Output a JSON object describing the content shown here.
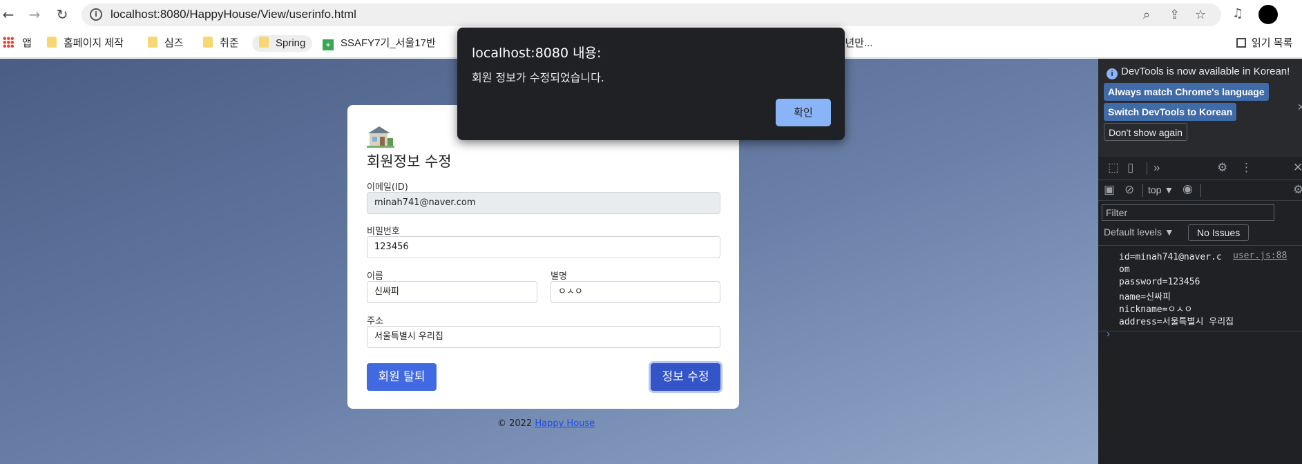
{
  "browser": {
    "url": "localhost:8080/HappyHouse/View/userinfo.html",
    "back_icon": "arrow-left-icon",
    "forward_icon": "arrow-right-icon",
    "reload_icon": "reload-icon"
  },
  "bookmarks": [
    {
      "label": "앱",
      "icon": "apps-grid-icon"
    },
    {
      "label": "홈페이지 제작",
      "icon": "folder-icon"
    },
    {
      "label": "심즈",
      "icon": "folder-icon"
    },
    {
      "label": "취준",
      "icon": "folder-icon"
    },
    {
      "label": "Spring",
      "icon": "folder-icon"
    },
    {
      "label": "SSAFY7기_서울17반",
      "icon": "green-plus-icon"
    },
    {
      "label": "1년만...",
      "icon": ""
    },
    {
      "label": "읽기 목록",
      "icon": "reading-list-icon"
    }
  ],
  "form": {
    "title": "회원정보 수정",
    "email_label": "이메일(ID)",
    "email_value": "minah741@naver.com",
    "password_label": "비밀번호",
    "password_value": "123456",
    "name_label": "이름",
    "name_value": "신싸피",
    "nickname_label": "별명",
    "nickname_value": "ㅇㅅㅇ",
    "address_label": "주소",
    "address_value": "서울특별시 우리집",
    "withdraw_button": "회원 탈퇴",
    "update_button": "정보 수정"
  },
  "footer": {
    "copyright": "© 2022",
    "link": "Happy House"
  },
  "alert": {
    "title": "localhost:8080 내용:",
    "message": "회원 정보가 수정되었습니다.",
    "ok_button": "확인"
  },
  "devtools": {
    "banner_message": "DevTools is now available in Korean!",
    "match_language_button": "Always match Chrome's language",
    "switch_korean_button": "Switch DevTools to Korean",
    "dont_show_button": "Don't show again",
    "context": "top ▼",
    "filter_placeholder": "Filter",
    "levels": "Default levels ▼",
    "issues": "No Issues",
    "log_source": "user.js:88",
    "log_lines": [
      "id=minah741@naver.c",
      "om",
      "password=123456",
      "name=신싸피",
      "nickname=ㅇㅅㅇ",
      "address=서울특별시 우리집"
    ]
  }
}
